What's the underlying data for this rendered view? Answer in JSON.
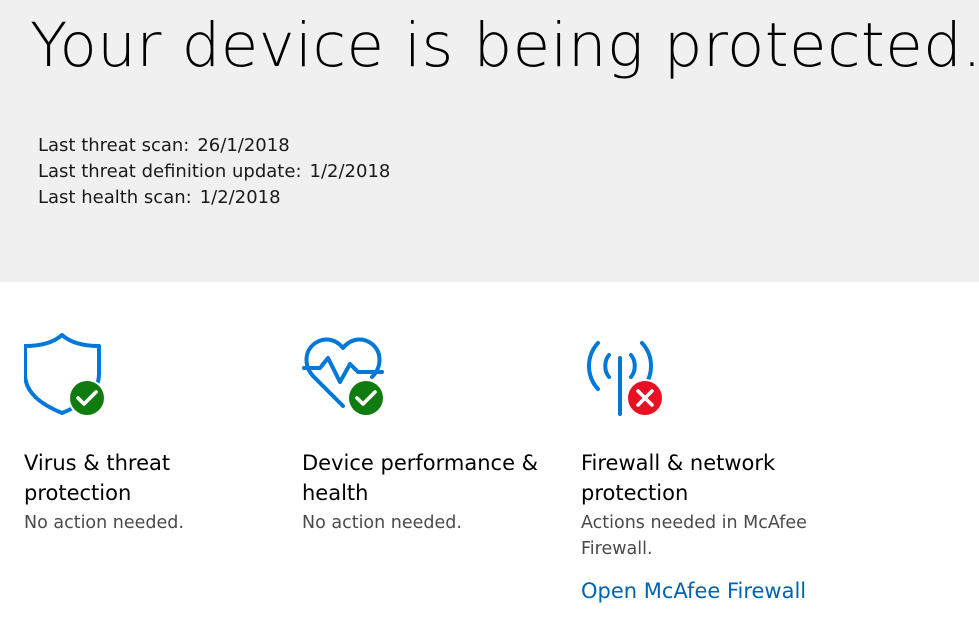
{
  "hero": {
    "title": "Your device is being protected.",
    "scans": [
      {
        "label": "Last threat scan:",
        "value": "26/1/2018"
      },
      {
        "label": "Last threat definition update:",
        "value": "1/2/2018"
      },
      {
        "label": "Last health scan:",
        "value": "1/2/2018"
      }
    ]
  },
  "tiles": [
    {
      "icon": "shield-icon",
      "status_icon": "checkmark-circle-icon",
      "title": "Virus & threat protection",
      "description": "No action needed."
    },
    {
      "icon": "heart-pulse-icon",
      "status_icon": "checkmark-circle-icon",
      "title": "Device performance & health",
      "description": "No action needed."
    },
    {
      "icon": "antenna-icon",
      "status_icon": "error-circle-icon",
      "title": "Firewall & network protection",
      "description": "Actions needed in McAfee Firewall.",
      "link": "Open McAfee Firewall"
    }
  ],
  "colors": {
    "icon_blue": "#0078d7",
    "ok_green": "#107c10",
    "error_red": "#e81123",
    "link_blue": "#0063b1",
    "hero_background": "#f0f0f0"
  }
}
